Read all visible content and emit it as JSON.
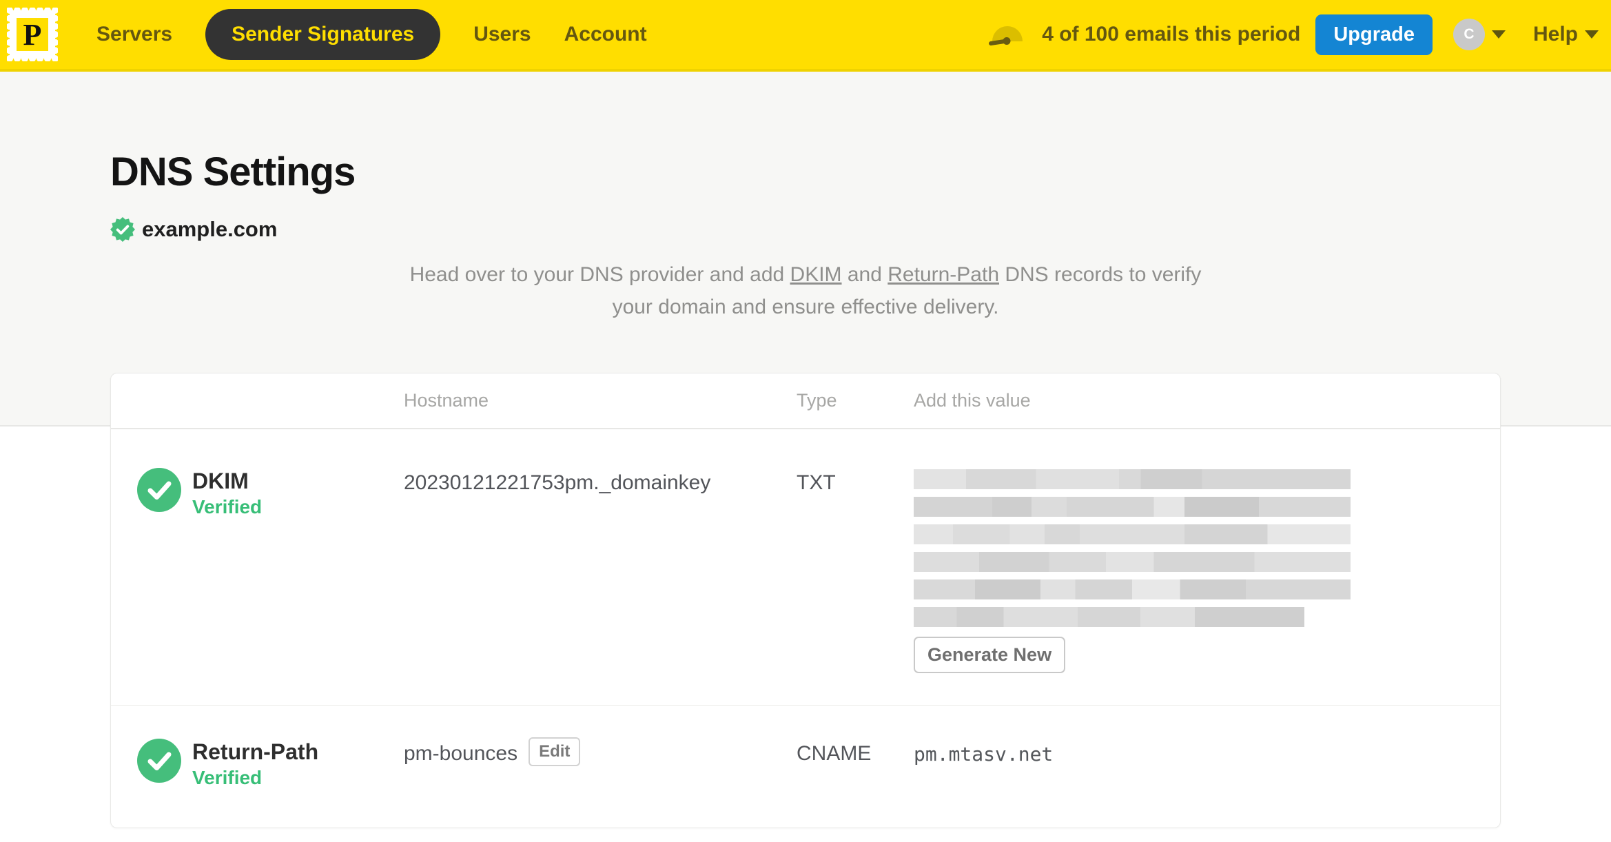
{
  "nav": {
    "brand_initial": "P",
    "items": [
      {
        "label": "Servers",
        "active": false
      },
      {
        "label": "Sender Signatures",
        "active": true
      },
      {
        "label": "Users",
        "active": false
      },
      {
        "label": "Account",
        "active": false
      }
    ],
    "usage_text": "4 of 100 emails this period",
    "upgrade_label": "Upgrade",
    "avatar_initial": "C",
    "help_label": "Help"
  },
  "page": {
    "title": "DNS Settings",
    "domain": "example.com",
    "description": {
      "prefix": "Head over to your DNS provider and add ",
      "link_dkim": "DKIM",
      "middle": " and ",
      "link_return_path": "Return-Path",
      "suffix": " DNS records to verify your domain and ensure effective delivery."
    }
  },
  "table": {
    "headers": {
      "hostname": "Hostname",
      "type": "Type",
      "value": "Add this value"
    },
    "rows": [
      {
        "name": "DKIM",
        "status": "Verified",
        "hostname": "20230121221753pm._domainkey",
        "type": "TXT",
        "value_redacted": true,
        "redacted_lines": 6,
        "action_label": "Generate New"
      },
      {
        "name": "Return-Path",
        "status": "Verified",
        "hostname": "pm-bounces",
        "edit_label": "Edit",
        "type": "CNAME",
        "value": "pm.mtasv.net"
      }
    ]
  },
  "colors": {
    "brand_yellow": "#FFDE00",
    "upgrade_blue": "#1485D3",
    "verified_green": "#45BE7C"
  }
}
